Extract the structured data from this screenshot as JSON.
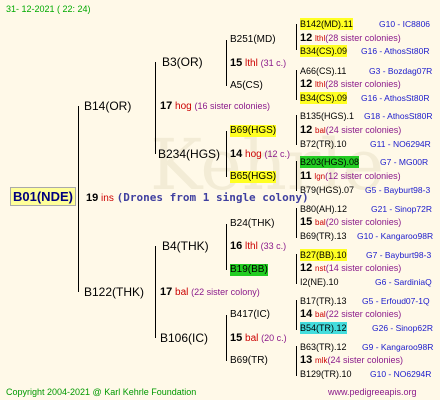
{
  "date": "31- 12-2021 ( 22: 24)",
  "footer_left": "Copyright 2004-2021 @ Karl Kehrle Foundation",
  "footer_right": "www.pedigreeapis.org",
  "watermark": "Kehrle",
  "root": {
    "name": "B01(NDE)",
    "num": "19",
    "rtag": "ins",
    "note": "(Drones from 1 single colony)"
  },
  "gen1": [
    {
      "name": "B14(OR)",
      "num": "17",
      "rtag": "hog",
      "note": "(16 sister colonies)"
    },
    {
      "name": "B122(THK)",
      "num": "17",
      "rtag": "bal",
      "note": "(22 sister colony)"
    }
  ],
  "gen2": [
    {
      "name": "B3(OR)",
      "num": "15",
      "rtag": "lthl",
      "note": "(31 c.)"
    },
    {
      "name": "B234(HGS)",
      "num": "14",
      "rtag": "hog",
      "note": "(12 c.)"
    },
    {
      "name": "B4(THK)",
      "num": "16",
      "rtag": "lthl",
      "note": "(33 c.)"
    },
    {
      "name": "B106(IC)",
      "num": "15",
      "rtag": "bal",
      "note": "(20 c.)"
    }
  ],
  "gen3": [
    {
      "name": "B251(MD)"
    },
    {
      "name": "A5(CS)"
    },
    {
      "name": "B69(HGS)"
    },
    {
      "name": "B65(HGS)"
    },
    {
      "name": "B24(THK)"
    },
    {
      "name": "B19(BB)"
    },
    {
      "name": "B417(IC)"
    },
    {
      "name": "B69(TR)"
    }
  ],
  "gen4": [
    {
      "top": "B142(MD).11",
      "code": "G10 - IC8806",
      "num": "12",
      "rtag": "lthl",
      "note": "(28 sister colonies)",
      "bottom": "B34(CS).09",
      "bcode": "G16 - AthosSt80R"
    },
    {
      "top": "A66(CS).11",
      "code": "G3 - Bozdag07R",
      "num": "12",
      "rtag": "lthl",
      "note": "(28 sister colonies)",
      "bottom": "B34(CS).09",
      "bcode": "G16 - AthosSt80R"
    },
    {
      "top": "B135(HGS).1",
      "code": "G18 - AthosSt80R",
      "num": "12",
      "rtag": "bal",
      "note": "(24 sister colonies)",
      "bottom": "B72(TR).10",
      "bcode": "G11 - NO6294R"
    },
    {
      "top": "B203(HGS).08",
      "code": "G7 - MG00R",
      "num": "11",
      "rtag": "lgn",
      "note": "(12 sister colonies)",
      "bottom": "B79(HGS).07",
      "bcode": "G5 - Bayburt98-3"
    },
    {
      "top": "B80(AH).12",
      "code": "G21 - Sinop72R",
      "num": "15",
      "rtag": "bal",
      "note": "(20 sister colonies)",
      "bottom": "B69(TR).13",
      "bcode": "G10 - Kangaroo98R"
    },
    {
      "top": "B27(BB).10",
      "code": "G7 - Bayburt98-3",
      "num": "12",
      "rtag": "nst",
      "note": "(14 sister colonies)",
      "bottom": "I2(NE).10",
      "bcode": "G6 - SardiniaQ"
    },
    {
      "top": "B17(TR).13",
      "code": "G5 - Erfoud07-1Q",
      "num": "14",
      "rtag": "bal",
      "note": "(22 sister colonies)",
      "bottom": "B54(TR).12",
      "bcode": "G26 - Sinop62R"
    },
    {
      "top": "B63(TR).12",
      "code": "G9 - Kangaroo98R",
      "num": "13",
      "rtag": "mlk",
      "note": "(24 sister colonies)",
      "bottom": "B129(TR).10",
      "bcode": "G10 - NO6294R"
    }
  ]
}
